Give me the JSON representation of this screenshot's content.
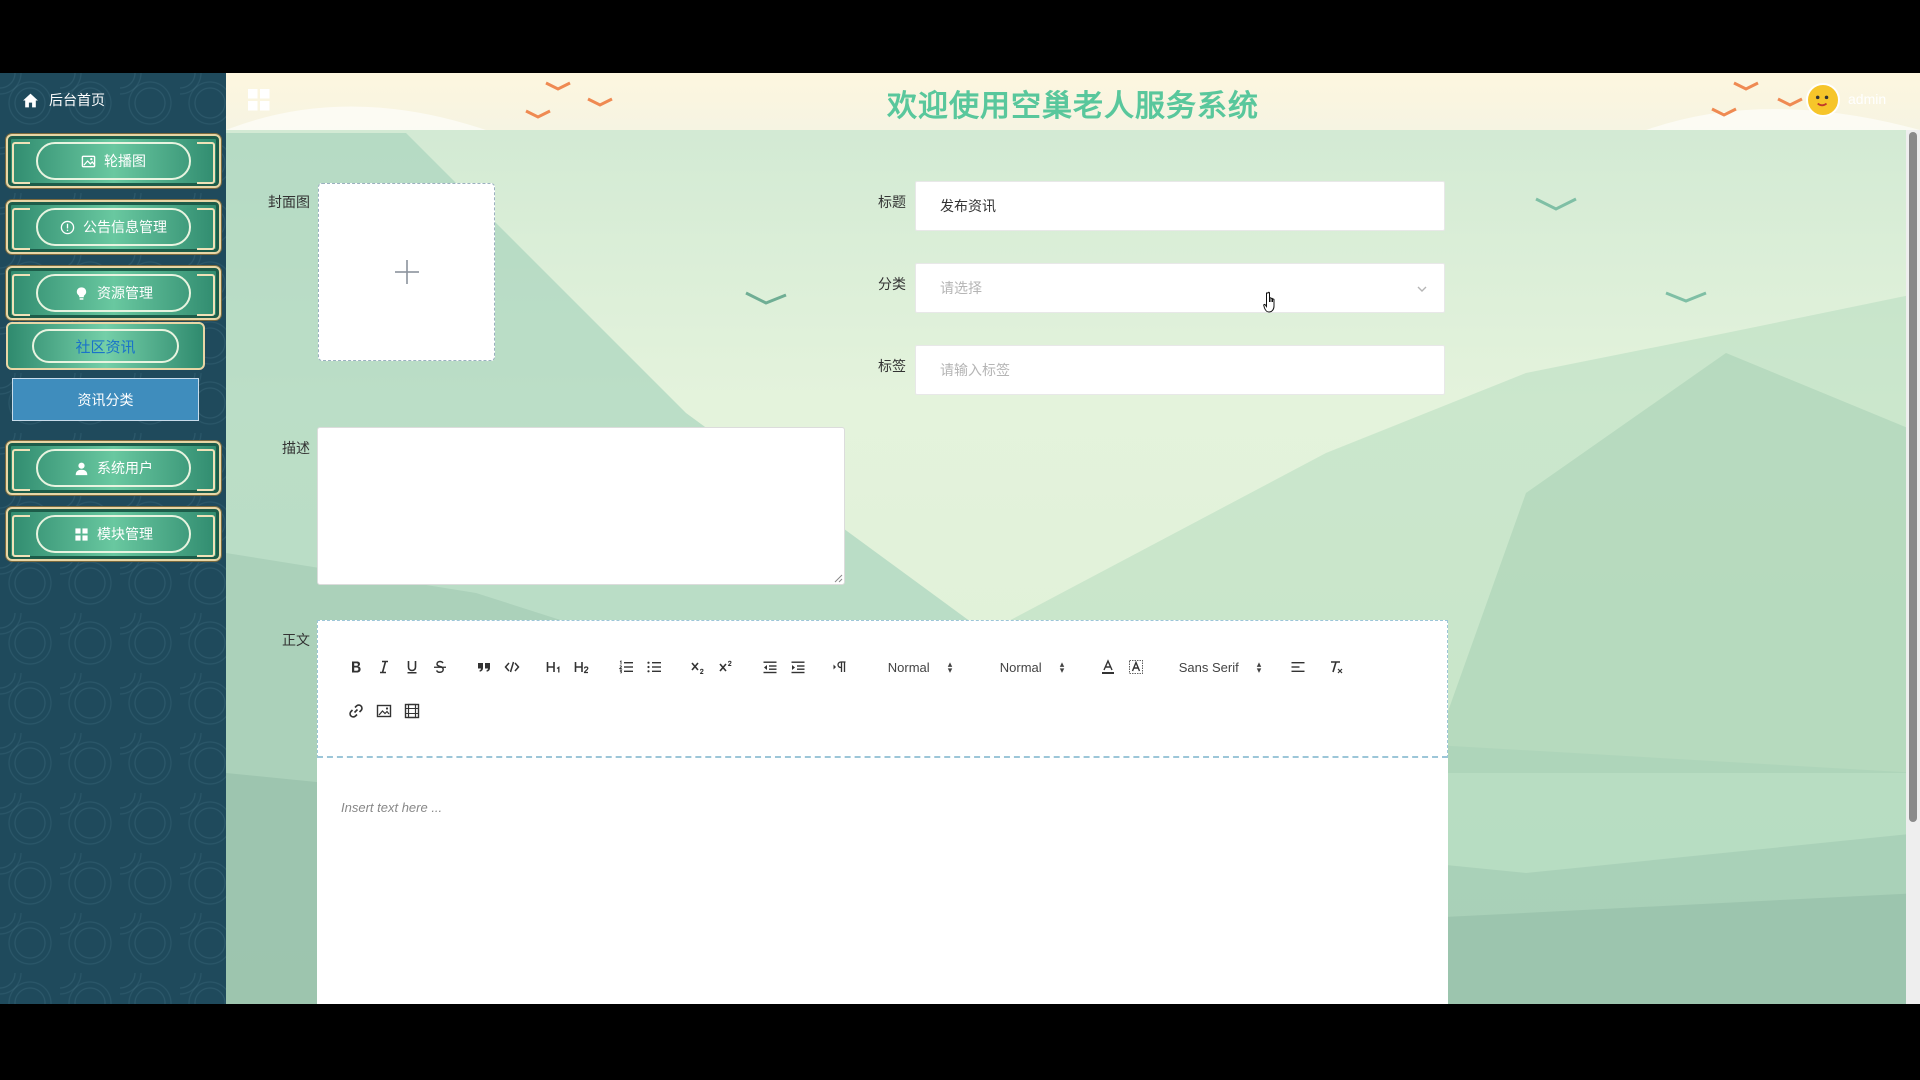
{
  "sidebar": {
    "home": "后台首页",
    "items": [
      {
        "label": "轮播图",
        "icon": "image-icon"
      },
      {
        "label": "公告信息管理",
        "icon": "info-circle-icon"
      },
      {
        "label": "资源管理",
        "icon": "bulb-icon"
      },
      {
        "label": "社区资讯",
        "icon": ""
      },
      {
        "label": "资讯分类",
        "icon": ""
      },
      {
        "label": "系统用户",
        "icon": "user-icon"
      },
      {
        "label": "模块管理",
        "icon": "grid-icon"
      }
    ]
  },
  "header": {
    "title": "欢迎使用空巢老人服务系统",
    "username": "admin"
  },
  "form": {
    "cover_label": "封面图",
    "title_label": "标题",
    "title_value": "发布资讯",
    "category_label": "分类",
    "category_placeholder": "请选择",
    "tags_label": "标签",
    "tags_placeholder": "请输入标签",
    "description_label": "描述",
    "body_label": "正文"
  },
  "editor": {
    "header_select": "Normal",
    "size_select": "Normal",
    "font_select": "Sans Serif",
    "placeholder": "Insert text here ..."
  }
}
